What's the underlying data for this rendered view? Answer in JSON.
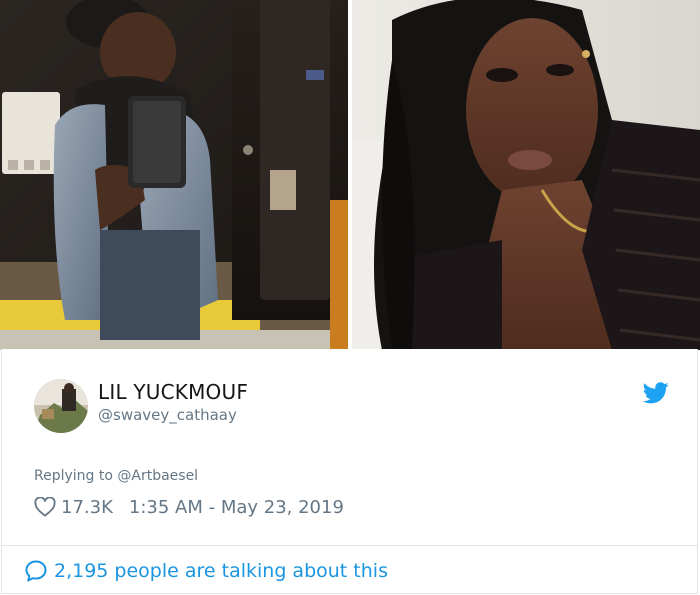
{
  "tweet": {
    "author_name": "LIL YUCKMOUF",
    "author_handle": "@swavey_cathaay",
    "reply_text": "Replying to @Artbaesel",
    "likes": "17.3K",
    "timestamp": "1:35 AM - May 23, 2019",
    "conversation": "2,195 people are talking about this"
  },
  "icons": {
    "like": "heart-icon",
    "brand": "twitter-bird-icon",
    "conversation": "speech-bubble-icon"
  },
  "colors": {
    "brand_blue": "#1da1f2",
    "link_blue": "#1b95e0",
    "muted_gray": "#657786",
    "text_dark": "#14171a"
  }
}
